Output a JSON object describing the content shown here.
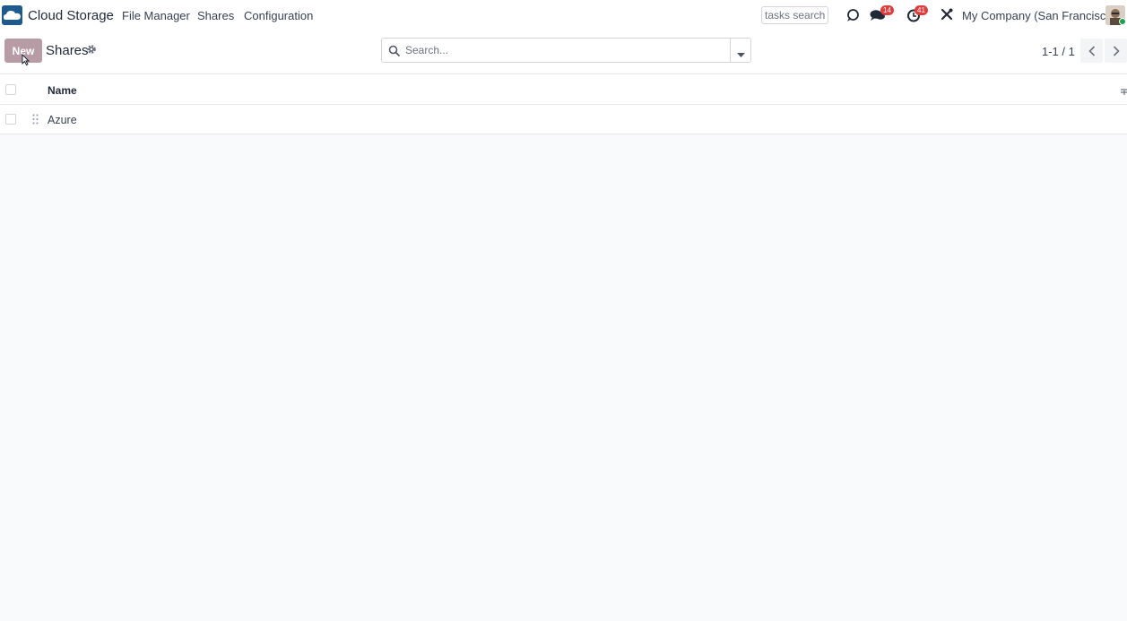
{
  "navbar": {
    "app_name": "Cloud Storage",
    "menu": [
      "File Manager",
      "Shares",
      "Configuration"
    ],
    "tasks_search_placeholder": "tasks search",
    "messages_badge": "14",
    "activities_badge": "41",
    "company": "My Company (San Francisco)"
  },
  "control_panel": {
    "new_button": "New",
    "title": "Shares",
    "search_placeholder": "Search...",
    "pager": "1-1 / 1"
  },
  "list": {
    "columns": [
      "Name"
    ],
    "rows": [
      {
        "name": "Azure"
      }
    ]
  },
  "colors": {
    "new_button": "#b79ca6",
    "badge": "#e03e3e",
    "logo": "#1f5a8f"
  },
  "icons": [
    "cloud-logo-icon",
    "settings-gear-icon",
    "search-icon",
    "caret-down-icon",
    "chevron-left-icon",
    "chevron-right-icon",
    "drag-handle-icon",
    "discuss-icon",
    "chat-icon",
    "activity-clock-icon",
    "tools-icon",
    "optional-columns-icon"
  ]
}
